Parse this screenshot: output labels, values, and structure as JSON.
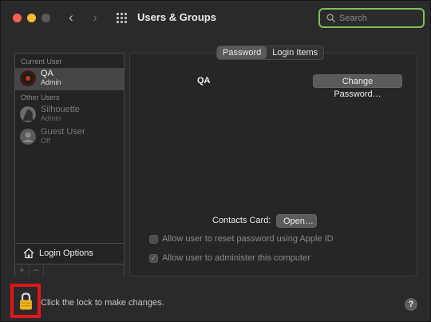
{
  "window": {
    "title": "Users & Groups"
  },
  "nav": {
    "back_glyph": "‹",
    "forward_glyph": "›"
  },
  "search": {
    "placeholder": "Search",
    "value": ""
  },
  "sidebar": {
    "current_user_label": "Current User",
    "other_users_label": "Other Users",
    "current_user": {
      "name": "QA",
      "role": "Admin",
      "selected": true
    },
    "other_users": [
      {
        "name": "Silhouette",
        "role": "Admin"
      },
      {
        "name": "Guest User",
        "role": "Off"
      }
    ],
    "login_options_label": "Login Options",
    "add_label": "+",
    "remove_label": "−"
  },
  "tabs": [
    {
      "label": "Password",
      "active": true
    },
    {
      "label": "Login Items",
      "active": false
    }
  ],
  "details": {
    "user_name": "QA",
    "change_password_label": "Change Password…",
    "contacts_card_label": "Contacts Card:",
    "open_label": "Open…",
    "checkbox_reset": {
      "label": "Allow user to reset password using Apple ID",
      "checked": false,
      "enabled": false
    },
    "checkbox_admin": {
      "label": "Allow user to administer this computer",
      "checked": true,
      "enabled": false
    }
  },
  "footer": {
    "lock_text": "Click the lock to make changes.",
    "help_label": "?"
  },
  "colors": {
    "lock_highlight": "#e2161b",
    "search_focus": "#7fbf5c"
  }
}
